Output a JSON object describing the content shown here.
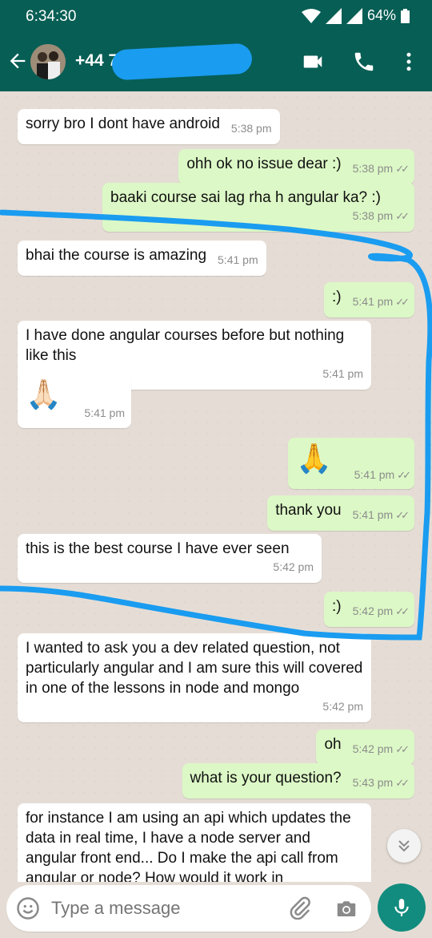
{
  "statusbar": {
    "time": "6:34:30",
    "battery": "64%"
  },
  "header": {
    "contact": "+44 7"
  },
  "messages": [
    {
      "dir": "in",
      "text": "sorry bro I dont have android",
      "time": "5:38 pm"
    },
    {
      "dir": "out",
      "text": "ohh ok no issue dear :)",
      "time": "5:38 pm"
    },
    {
      "dir": "out",
      "text": "baaki course sai lag rha h angular ka? :)",
      "time": "5:38 pm"
    },
    {
      "dir": "in",
      "text": "bhai the course is amazing",
      "time": "5:41 pm"
    },
    {
      "dir": "out",
      "text": ":)",
      "time": "5:41 pm"
    },
    {
      "dir": "in",
      "text": "I have done angular courses before but nothing like this",
      "time": "5:41 pm"
    },
    {
      "dir": "in",
      "text": "🙏🏻",
      "time": "5:41 pm"
    },
    {
      "dir": "out",
      "text": "🙏",
      "time": "5:41 pm"
    },
    {
      "dir": "out",
      "text": "thank you",
      "time": "5:41 pm"
    },
    {
      "dir": "in",
      "text": "this is the best course I have ever seen",
      "time": "5:42 pm"
    },
    {
      "dir": "out",
      "text": ":)",
      "time": "5:42 pm"
    },
    {
      "dir": "in",
      "text": "I wanted to ask you a dev related question, not particularly angular  and I am sure this will covered in one of the lessons in node and mongo",
      "time": "5:42 pm"
    },
    {
      "dir": "out",
      "text": "oh",
      "time": "5:42 pm"
    },
    {
      "dir": "out",
      "text": "what is your question?",
      "time": "5:43 pm"
    },
    {
      "dir": "in",
      "text": "for instance I am using an api which updates the data in real time, I have a node server and angular front end... Do I make the api call from angular or node? How would it work in",
      "time": ""
    }
  ],
  "composer": {
    "placeholder": "Type a message"
  },
  "colors": {
    "header": "#075e54",
    "outgoing": "#dcf8c6",
    "incoming": "#ffffff",
    "mic": "#128c7e",
    "marker": "#1a9cf0"
  }
}
